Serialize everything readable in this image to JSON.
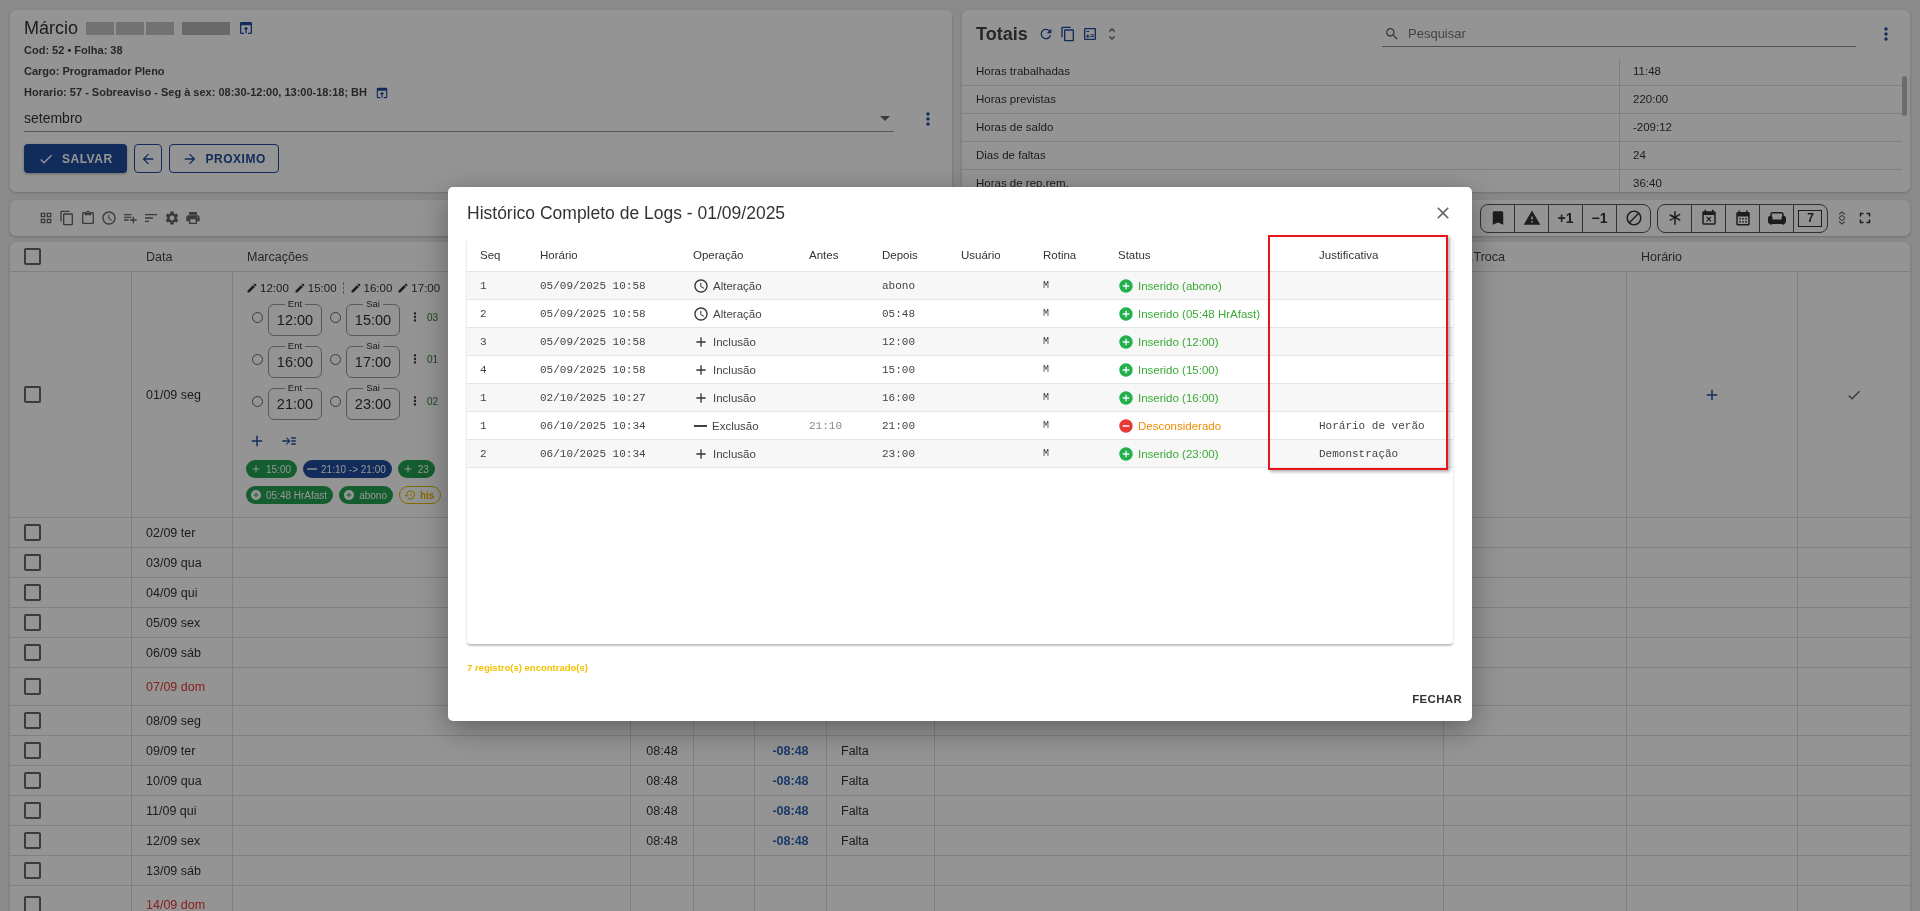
{
  "employee": {
    "first_name": "Márcio",
    "code_line": "Cod: 52 • Folha: 38",
    "cargo": "Cargo: Programador Pleno",
    "horario": "Horario: 57 - Sobreaviso - Seg à sex: 08:30-12:00, 13:00-18:18; BH"
  },
  "month_select": {
    "value": "setembro"
  },
  "actions": [
    {
      "kind": "primary",
      "label": "SALVAR"
    },
    {
      "kind": "back"
    },
    {
      "kind": "next",
      "label": "PROXIMO"
    }
  ],
  "totals": {
    "title": "Totais",
    "search": {
      "placeholder": "Pesquisar"
    },
    "rows": [
      {
        "label": "Horas trabalhadas",
        "value": "11:48"
      },
      {
        "label": "Horas previstas",
        "value": "220:00"
      },
      {
        "label": "Horas de saldo",
        "value": "-209:12"
      },
      {
        "label": "Dias de faltas",
        "value": "24"
      },
      {
        "label": "Horas de rep.rem.",
        "value": "36:40"
      }
    ]
  },
  "toolbar": {
    "plus_one": "+1",
    "minus_one": "−1",
    "day_badge": "7"
  },
  "grid": {
    "all_checked": false,
    "headers": {
      "data": "Data",
      "marcacoes": "Marcações",
      "troca": ".Troca",
      "horario": "Horário"
    }
  },
  "days": [
    {
      "date": "01/09 seg",
      "checked": false,
      "sunday": false,
      "actions": true,
      "marcacoes": {
        "summary": [
          "12:00",
          "15:00",
          "16:00",
          "17:00"
        ],
        "pairs": [
          {
            "in_label": "Ent",
            "in": "12:00",
            "in_checked": false,
            "out_label": "Sai",
            "out": "15:00",
            "out_checked": false,
            "note": "03"
          },
          {
            "in_label": "Ent",
            "in": "16:00",
            "in_checked": false,
            "out_label": "Sai",
            "out": "17:00",
            "out_checked": false,
            "note": "01"
          },
          {
            "in_label": "Ent",
            "in": "21:00",
            "in_checked": false,
            "out_label": "Sai",
            "out": "23:00",
            "out_checked": false,
            "note": "02"
          }
        ],
        "chips": [
          {
            "kind": "add",
            "label": "15:00"
          },
          {
            "kind": "change",
            "label": "21:10 -> 21:00"
          },
          {
            "kind": "add",
            "label": "23"
          }
        ],
        "chips2": [
          {
            "kind": "add_circle",
            "label": "05:48 HrAfast"
          },
          {
            "kind": "add_circle",
            "label": "abono"
          },
          {
            "kind": "history",
            "label": "his"
          }
        ]
      }
    },
    {
      "date": "02/09 ter",
      "checked": false,
      "sunday": false
    },
    {
      "date": "03/09 qua",
      "checked": false,
      "sunday": false
    },
    {
      "date": "04/09 qui",
      "checked": false,
      "sunday": false
    },
    {
      "date": "05/09 sex",
      "checked": false,
      "sunday": false
    },
    {
      "date": "06/09 sáb",
      "checked": false,
      "sunday": false
    },
    {
      "date": "07/09 dom",
      "checked": false,
      "sunday": true
    },
    {
      "date": "08/09 seg",
      "checked": false,
      "sunday": false
    },
    {
      "date": "09/09 ter",
      "checked": false,
      "sunday": false,
      "prevista": "08:48",
      "saldo": "-08:48",
      "ocorrencia": "Falta"
    },
    {
      "date": "10/09 qua",
      "checked": false,
      "sunday": false,
      "prevista": "08:48",
      "saldo": "-08:48",
      "ocorrencia": "Falta"
    },
    {
      "date": "11/09 qui",
      "checked": false,
      "sunday": false,
      "prevista": "08:48",
      "saldo": "-08:48",
      "ocorrencia": "Falta"
    },
    {
      "date": "12/09 sex",
      "checked": false,
      "sunday": false,
      "prevista": "08:48",
      "saldo": "-08:48",
      "ocorrencia": "Falta"
    },
    {
      "date": "13/09 sáb",
      "checked": false,
      "sunday": false
    },
    {
      "date": "14/09 dom",
      "checked": false,
      "sunday": true
    }
  ],
  "modal": {
    "title": "Histórico Completo de Logs - 01/09/2025",
    "columns": [
      {
        "label": "Seq"
      },
      {
        "label": "Horário"
      },
      {
        "label": "Operação"
      },
      {
        "label": "Antes"
      },
      {
        "label": "Depois"
      },
      {
        "label": "Usuário"
      },
      {
        "label": "Rotina"
      },
      {
        "label": "Status"
      },
      {
        "label": "Justificativa",
        "highlighted": true
      }
    ],
    "rows": [
      {
        "seq": "1",
        "time": "05/09/2025 10:58",
        "operation": {
          "kind": "change",
          "label": "Alteração"
        },
        "after": "abono",
        "routine": "M",
        "status": {
          "kind": "inserted",
          "label": "Inserido (abono)"
        }
      },
      {
        "seq": "2",
        "time": "05/09/2025 10:58",
        "operation": {
          "kind": "change",
          "label": "Alteração"
        },
        "after": "05:48",
        "routine": "M",
        "status": {
          "kind": "inserted",
          "label": "Inserido (05:48 HrAfast)"
        }
      },
      {
        "seq": "3",
        "time": "05/09/2025 10:58",
        "operation": {
          "kind": "include",
          "label": "Inclusão"
        },
        "after": "12:00",
        "routine": "M",
        "status": {
          "kind": "inserted",
          "label": "Inserido (12:00)"
        }
      },
      {
        "seq": "4",
        "time": "05/09/2025 10:58",
        "operation": {
          "kind": "include",
          "label": "Inclusão"
        },
        "after": "15:00",
        "routine": "M",
        "status": {
          "kind": "inserted",
          "label": "Inserido (15:00)"
        }
      },
      {
        "seq": "1",
        "time": "02/10/2025 10:27",
        "operation": {
          "kind": "include",
          "label": "Inclusão"
        },
        "after": "16:00",
        "routine": "M",
        "status": {
          "kind": "inserted",
          "label": "Inserido (16:00)"
        }
      },
      {
        "seq": "1",
        "time": "06/10/2025 10:34",
        "operation": {
          "kind": "exclude",
          "label": "Exclusão"
        },
        "before": "21:10",
        "after": "21:00",
        "routine": "M",
        "status": {
          "kind": "disregarded",
          "label": "Desconsiderado"
        },
        "justification": "Horário de verão"
      },
      {
        "seq": "2",
        "time": "06/10/2025 10:34",
        "operation": {
          "kind": "include",
          "label": "Inclusão"
        },
        "after": "23:00",
        "routine": "M",
        "status": {
          "kind": "inserted",
          "label": "Inserido (23:00)"
        },
        "justification": "Demonstração"
      }
    ],
    "count_text": "7 registro(s) encontrado(s)",
    "close_label": "FECHAR"
  }
}
